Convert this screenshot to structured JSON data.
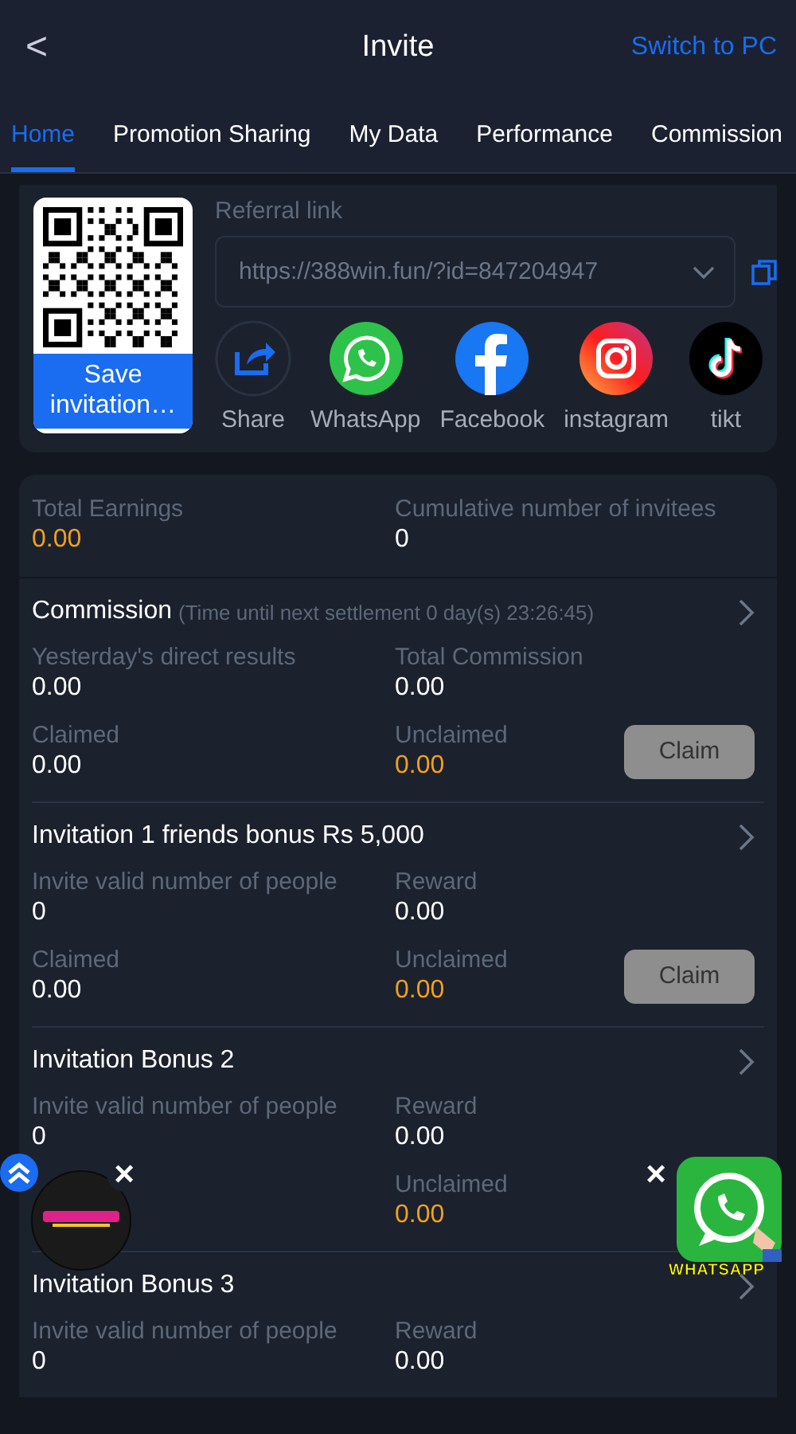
{
  "header": {
    "back": "<",
    "title": "Invite",
    "switch": "Switch to PC"
  },
  "tabs": [
    {
      "label": "Home",
      "selected": true
    },
    {
      "label": "Promotion Sharing",
      "selected": false
    },
    {
      "label": "My Data",
      "selected": false
    },
    {
      "label": "Performance",
      "selected": false
    },
    {
      "label": "Commission",
      "selected": false
    }
  ],
  "share": {
    "save_button": "Save invitation…",
    "referral_label": "Referral link",
    "referral_link": "https://388win.fun/?id=847204947",
    "channels": [
      {
        "kind": "share",
        "label": "Share"
      },
      {
        "kind": "whatsapp",
        "label": "WhatsApp"
      },
      {
        "kind": "facebook",
        "label": "Facebook"
      },
      {
        "kind": "instagram",
        "label": "instagram"
      },
      {
        "kind": "tiktok",
        "label": "tikt"
      }
    ]
  },
  "summary": [
    {
      "label": "Total Earnings",
      "value": "0.00",
      "highlight": true
    },
    {
      "label": "Cumulative number of invitees",
      "value": "0",
      "highlight": false
    }
  ],
  "sections": [
    {
      "title": "Commission",
      "note": "(Time until next settlement  0 day(s) 23:26:45)",
      "fields": [
        {
          "label": "Yesterday's direct results",
          "value": "0.00",
          "highlight": false
        },
        {
          "label": "Total Commission",
          "value": "0.00",
          "highlight": false
        },
        {
          "label": "Claimed",
          "value": "0.00",
          "highlight": false
        },
        {
          "label": "Unclaimed",
          "value": "0.00",
          "highlight": true
        }
      ],
      "claim": "Claim"
    },
    {
      "title": "Invitation 1 friends bonus Rs 5,000",
      "fields": [
        {
          "label": "Invite valid number of people",
          "value": "0",
          "highlight": false
        },
        {
          "label": "Reward",
          "value": "0.00",
          "highlight": false
        },
        {
          "label": "Claimed",
          "value": "0.00",
          "highlight": false
        },
        {
          "label": "Unclaimed",
          "value": "0.00",
          "highlight": true
        }
      ],
      "claim": "Claim"
    },
    {
      "title": "Invitation Bonus 2",
      "fields": [
        {
          "label": "Invite valid number of people",
          "value": "0",
          "highlight": false
        },
        {
          "label": "Reward",
          "value": "0.00",
          "highlight": false
        },
        {
          "label": "Unclaimed",
          "value": "0.00",
          "highlight": true,
          "right_column": true
        }
      ]
    },
    {
      "title": "Invitation Bonus 3",
      "fields": [
        {
          "label": "Invite valid number of people",
          "value": "0",
          "highlight": false
        },
        {
          "label": "Reward",
          "value": "0.00",
          "highlight": false
        }
      ]
    }
  ],
  "floating": {
    "close_left": "×",
    "close_right": "×",
    "whatsapp_label": "WHATSAPP"
  }
}
